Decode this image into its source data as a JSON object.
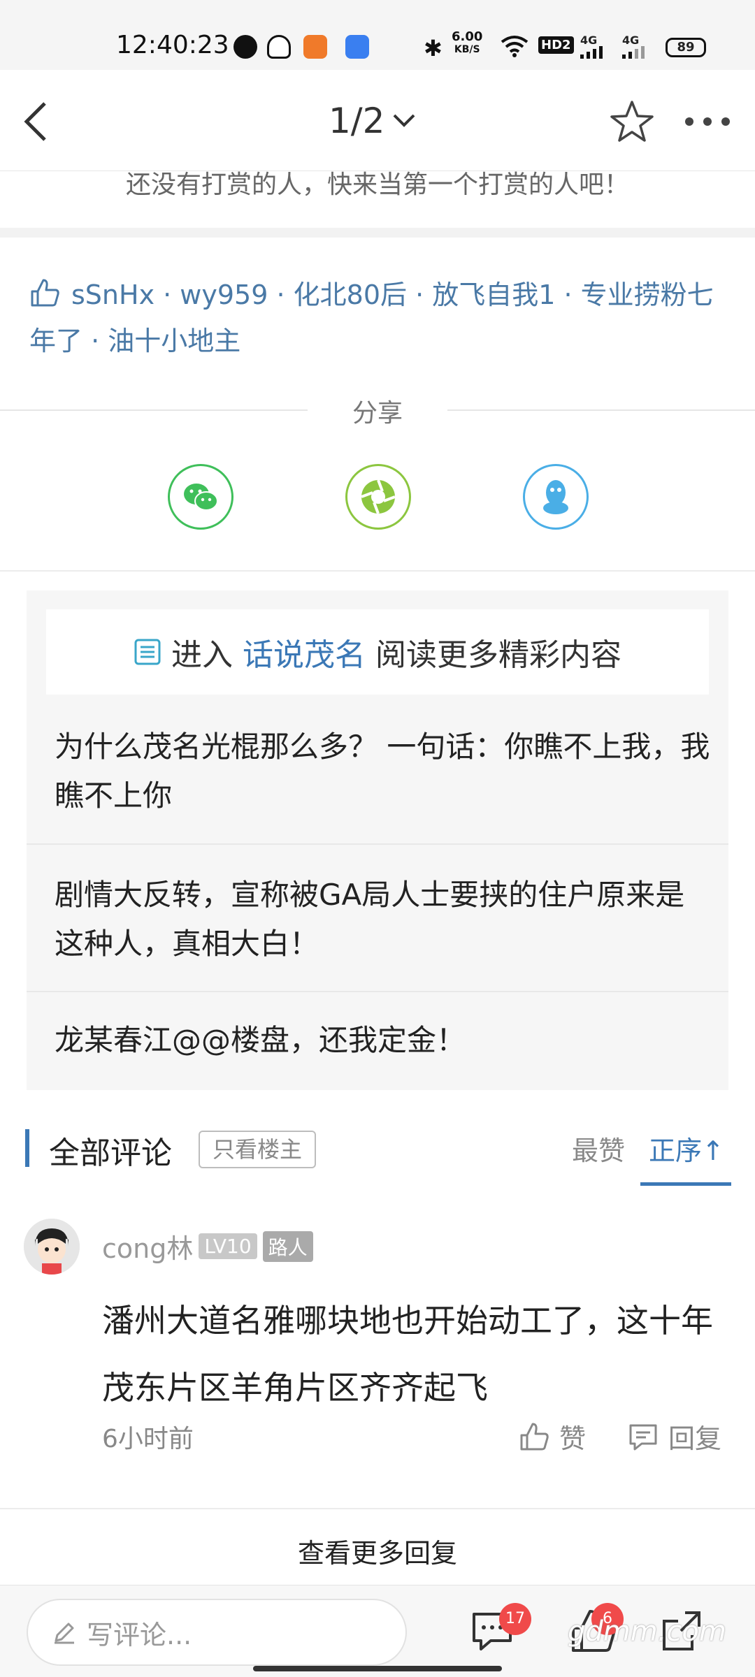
{
  "status_bar": {
    "time": "12:40:23",
    "net_speed_value": "6.00",
    "net_speed_unit": "KB/S",
    "hd_label": "HD2",
    "signal1_label": "4G",
    "signal2_label": "4G",
    "battery": "89"
  },
  "nav": {
    "page_indicator": "1/2"
  },
  "reward": {
    "text": "还没有打赏的人，快来当第一个打赏的人吧！"
  },
  "likes": {
    "users_text": "sSnHx · wy959 · 化北80后 · 放飞自我1 · 专业捞粉七年了 · 油十小地主"
  },
  "share": {
    "label": "分享",
    "targets": [
      "wechat-icon",
      "moments-icon",
      "qq-icon"
    ]
  },
  "recommend": {
    "enter": "进入",
    "forum_name": "话说茂名",
    "suffix": "阅读更多精彩内容",
    "items": [
      "为什么茂名光棍那么多？ 一句话：你瞧不上我，我瞧不上你",
      "剧情大反转，宣称被GA局人士要挟的住户原来是这种人，真相大白！",
      "龙某春江@@楼盘，还我定金！"
    ]
  },
  "comments": {
    "title": "全部评论",
    "only_owner": "只看楼主",
    "sort_hot": "最赞",
    "sort_asc": "正序↑",
    "items": [
      {
        "user": "cong林",
        "level": "LV10",
        "rank": "路人",
        "body": "潘州大道名雅哪块地也开始动工了，这十年茂东片区羊角片区齐齐起飞",
        "time": "6小时前",
        "like_label": "赞",
        "reply_label": "回复"
      }
    ],
    "more_replies": "查看更多回复"
  },
  "bottom_bar": {
    "input_placeholder": "写评论...",
    "comment_count": "17",
    "like_count": "6",
    "watermark": "gdmm.com"
  },
  "colors": {
    "accent": "#3b78b6",
    "like_link": "#4a79a6",
    "badge_red": "#f04a4a",
    "wechat_green": "#3fbf5a",
    "moments_green": "#8cc63f",
    "qq_blue": "#4aaee6"
  }
}
